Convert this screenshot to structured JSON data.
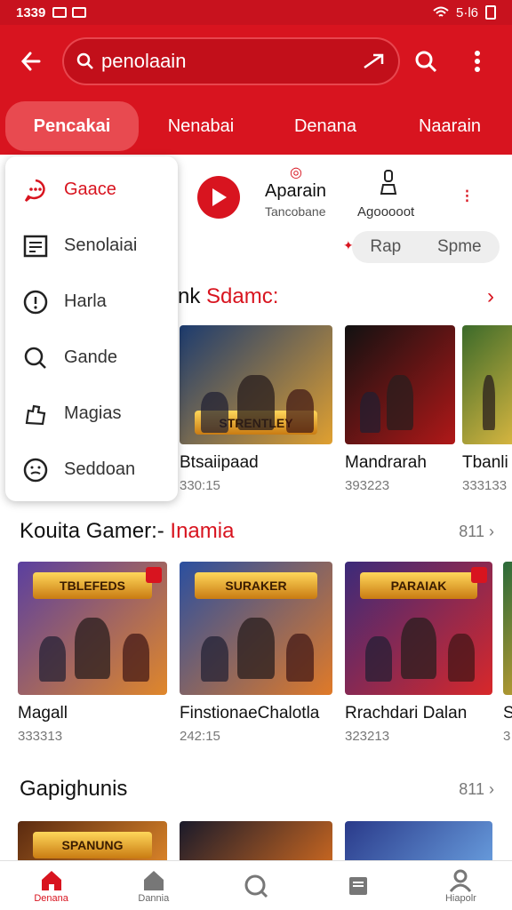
{
  "status_bar": {
    "time": "1339",
    "right_text": "5·l6"
  },
  "search": {
    "value": "penolaain"
  },
  "tabs": [
    "Pencakai",
    "Nenabai",
    "Denana",
    "Naarain"
  ],
  "dropdown": {
    "items": [
      {
        "label": "Gaace",
        "icon": "chat-icon"
      },
      {
        "label": "Senolaiai",
        "icon": "list-icon"
      },
      {
        "label": "Harla",
        "icon": "info-icon"
      },
      {
        "label": "Gande",
        "icon": "search-icon"
      },
      {
        "label": "Magias",
        "icon": "puzzle-icon"
      },
      {
        "label": "Seddoan",
        "icon": "smiley-icon"
      }
    ]
  },
  "quick": {
    "primary_title": "Aparain",
    "primary_sub": "Tancobane",
    "secondary_label": "Agooooot",
    "chips": [
      "Rap",
      "Spme"
    ]
  },
  "section1": {
    "title_black": "nk",
    "title_red": "Sdamc:",
    "cards": [
      {
        "title": "Btsaiipaad",
        "meta": "330:15",
        "banner": "STRENTLEY",
        "colors": [
          "#1c3b6f",
          "#e0a030"
        ]
      },
      {
        "title": "Mandrarah",
        "meta": "393223",
        "banner": "",
        "colors": [
          "#111111",
          "#b01818"
        ]
      },
      {
        "title": "Tbanli",
        "meta": "333133",
        "banner": "",
        "colors": [
          "#3b6a2a",
          "#d8b640"
        ]
      }
    ]
  },
  "section2": {
    "title_black": "Kouita Gamer:-",
    "title_red": "Inamia",
    "more": "811",
    "cards": [
      {
        "title": "Magall",
        "meta": "333313",
        "banner": "TBLEFEDS",
        "colors": [
          "#5a3fa0",
          "#e0872a"
        ]
      },
      {
        "title": "FinstionaeChalotla",
        "meta": "242:15",
        "banner": "SURAKER",
        "colors": [
          "#2a4fa0",
          "#e07a28"
        ]
      },
      {
        "title": "Rrachdari Dalan",
        "meta": "323213",
        "banner": "PARAIAK",
        "colors": [
          "#3b2a7a",
          "#d8282a"
        ]
      },
      {
        "title": "S",
        "meta": "3",
        "banner": "",
        "colors": [
          "#2a6a3a",
          "#c8a030"
        ]
      }
    ]
  },
  "section3": {
    "title": "Gapighunis",
    "more": "811",
    "cards": [
      {
        "banner": "SPANUNG",
        "colors": [
          "#5a2a10",
          "#e0882a"
        ]
      },
      {
        "banner": "",
        "colors": [
          "#1a1a2a",
          "#d06a20"
        ]
      },
      {
        "banner": "",
        "colors": [
          "#2a3a8a",
          "#6aa0e0"
        ]
      }
    ]
  },
  "bottom_nav": [
    {
      "label": "Denana",
      "icon": "home-icon"
    },
    {
      "label": "Dannia",
      "icon": "house-icon"
    },
    {
      "label": "",
      "icon": "search-icon"
    },
    {
      "label": "",
      "icon": "inbox-icon"
    },
    {
      "label": "Hiapolr",
      "icon": "profile-icon"
    }
  ],
  "colors": {
    "brand": "#d8141f",
    "tab_active": "#e84a50"
  }
}
